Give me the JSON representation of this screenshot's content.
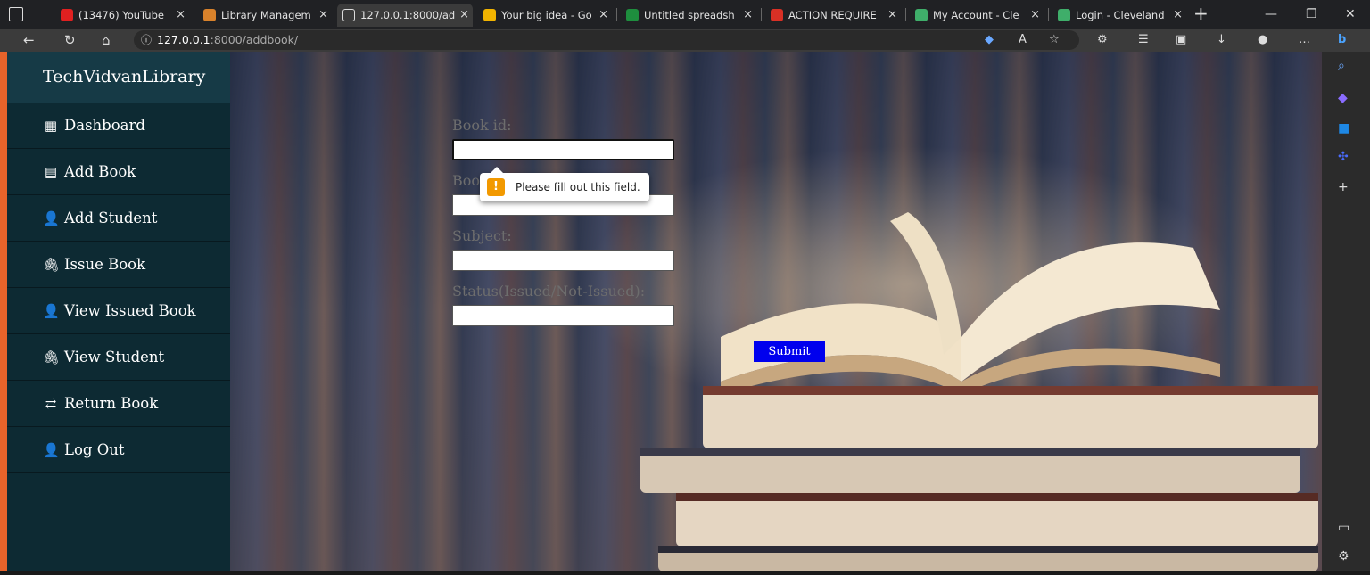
{
  "browser": {
    "tabs": [
      {
        "title": "(13476) YouTube",
        "favicon_color": "#e02020",
        "active": false
      },
      {
        "title": "Library Managem",
        "favicon_color": "#d9822b",
        "active": false
      },
      {
        "title": "127.0.0.1:8000/ad",
        "favicon_color": "#3b3b3b",
        "active": true
      },
      {
        "title": "Your big idea - Go",
        "favicon_color": "#f2b400",
        "active": false
      },
      {
        "title": "Untitled spreadsh",
        "favicon_color": "#1e8e3e",
        "active": false
      },
      {
        "title": "ACTION REQUIRE",
        "favicon_color": "#d93025",
        "active": false
      },
      {
        "title": "My Account - Cle",
        "favicon_color": "#3fae6a",
        "active": false
      },
      {
        "title": "Login - Cleveland",
        "favicon_color": "#3fae6a",
        "active": false
      }
    ],
    "tab_close": "×",
    "new_tab": "+",
    "url_host": "127.0.0.1",
    "url_path": ":8000/addbook/"
  },
  "sidebar": {
    "brand": "TechVidvanLibrary",
    "items": [
      {
        "label": "Dashboard",
        "icon": "dashboard-icon",
        "glyph": "▦"
      },
      {
        "label": "Add Book",
        "icon": "book-icon",
        "glyph": "▤"
      },
      {
        "label": "Add Student",
        "icon": "user-icon",
        "glyph": "👤"
      },
      {
        "label": "Issue Book",
        "icon": "paperclip-icon",
        "glyph": "🖇"
      },
      {
        "label": "View Issued Book",
        "icon": "user-icon",
        "glyph": "👤"
      },
      {
        "label": "View Student",
        "icon": "paperclip-icon",
        "glyph": "🖇"
      },
      {
        "label": "Return Book",
        "icon": "exchange-icon",
        "glyph": "⇄"
      },
      {
        "label": "Log Out",
        "icon": "user-icon",
        "glyph": "👤"
      }
    ]
  },
  "form": {
    "book_id_label": "Book id:",
    "book_name_label": "Boo",
    "subject_label": "Subject:",
    "status_label": "Status(Issued/Not-Issued):",
    "submit_label": "Submit",
    "validation_message": "Please fill out this field."
  },
  "colors": {
    "sidebar_bg": "#0d2a33",
    "brand_bg": "#163a46",
    "submit_bg": "#0000ee",
    "warning": "#f29900"
  }
}
